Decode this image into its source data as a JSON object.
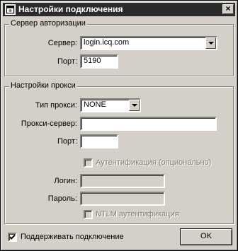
{
  "window": {
    "title": "Настройки подключения",
    "close_glyph": "×"
  },
  "auth_group": {
    "title": "Сервер авторизации",
    "server_label": "Сервер:",
    "server_value": "login.icq.com",
    "port_label": "Порт:",
    "port_value": "5190"
  },
  "proxy_group": {
    "title": "Настройки прокси",
    "proxy_type_label": "Тип прокси:",
    "proxy_type_value": "NONE",
    "proxy_server_label": "Прокси-сервер:",
    "proxy_server_value": "",
    "proxy_port_label": "Порт:",
    "proxy_port_value": "",
    "auth_checkbox_label": "Аутентификация (опционально)",
    "login_label": "Логин:",
    "login_value": "",
    "password_label": "Пароль:",
    "password_value": "",
    "ntlm_checkbox_label": "NTLM аутентификация"
  },
  "footer": {
    "keepalive_label": "Поддерживать подключение",
    "keepalive_checked": true,
    "ok_label": "OK"
  },
  "icons": {
    "app": "app-window-icon",
    "close": "close-icon",
    "dropdown": "chevron-down-icon",
    "checkmark": "checkmark-icon"
  }
}
